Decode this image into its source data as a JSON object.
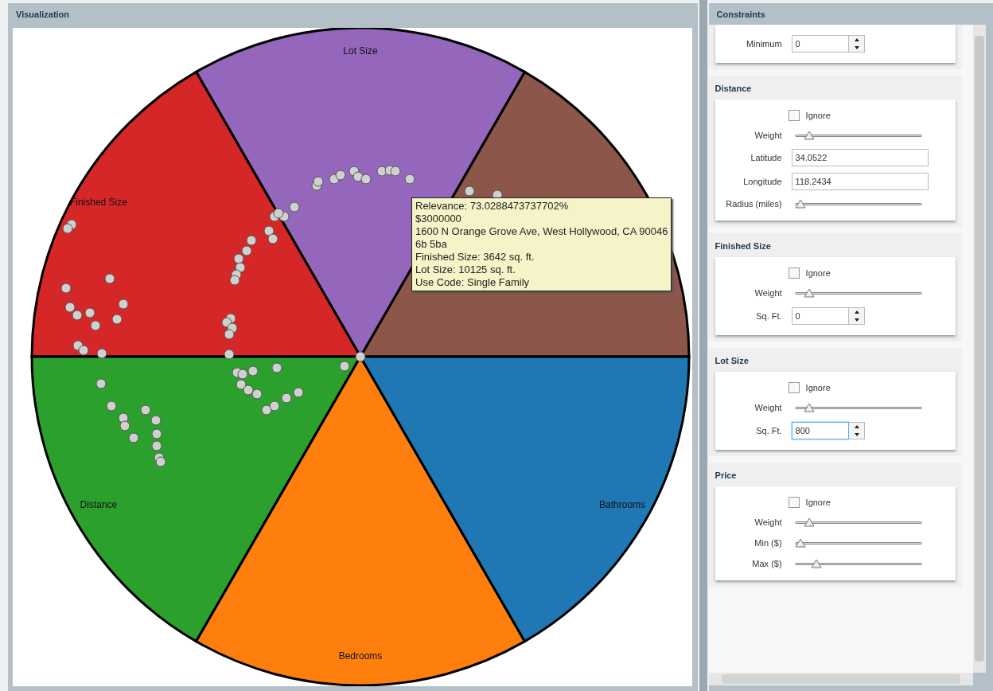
{
  "visualization": {
    "title": "Visualization",
    "segments": [
      {
        "color": "#8c564b"
      },
      {
        "label": "Lot Size",
        "color": "#9467bd"
      },
      {
        "label": "Finished Size",
        "color": "#d62728"
      },
      {
        "label": "Distance",
        "color": "#2ca02c"
      },
      {
        "label": "Bedrooms",
        "color": "#ff7f0e"
      },
      {
        "label": "Bathrooms",
        "color": "#1f77b4"
      }
    ],
    "tooltip": [
      "Relevance: 73.0288473737702%",
      "$3000000",
      "1600 N Orange Grove Ave, West Hollywood, CA 90046",
      "6b 5ba",
      "Finished Size: 3642 sq. ft.",
      "Lot Size: 10125 sq. ft.",
      "Use Code: Single Family"
    ]
  },
  "constraints": {
    "title": "Constraints",
    "sections": [
      {
        "rows": [
          {
            "kind": "spinner",
            "label": "Minimum",
            "value": "0",
            "focused": false
          }
        ]
      },
      {
        "title": "Distance",
        "rows": [
          {
            "kind": "checkbox",
            "label": "Ignore",
            "checked": false
          },
          {
            "kind": "slider",
            "label": "Weight",
            "level": 0.08
          },
          {
            "kind": "text",
            "label": "Latitude",
            "value": "34.0522"
          },
          {
            "kind": "text",
            "label": "Longitude",
            "value": "118.2434"
          },
          {
            "kind": "slider",
            "label": "Radius (miles)",
            "level": 0.0
          }
        ]
      },
      {
        "title": "Finished Size",
        "rows": [
          {
            "kind": "checkbox",
            "label": "Ignore",
            "checked": false
          },
          {
            "kind": "slider",
            "label": "Weight",
            "level": 0.08
          },
          {
            "kind": "spinner",
            "label": "Sq. Ft.",
            "value": "0",
            "focused": false
          }
        ]
      },
      {
        "title": "Lot Size",
        "rows": [
          {
            "kind": "checkbox",
            "label": "Ignore",
            "checked": false
          },
          {
            "kind": "slider",
            "label": "Weight",
            "level": 0.08
          },
          {
            "kind": "spinner",
            "label": "Sq. Ft.",
            "value": "800",
            "focused": true
          }
        ]
      },
      {
        "title": "Price",
        "rows": [
          {
            "kind": "checkbox",
            "label": "Ignore",
            "checked": false
          },
          {
            "kind": "slider",
            "label": "Weight",
            "level": 0.08
          },
          {
            "kind": "slider",
            "label": "Min ($)",
            "level": 0.0
          },
          {
            "kind": "slider",
            "label": "Max ($)",
            "level": 0.14
          }
        ]
      }
    ]
  }
}
